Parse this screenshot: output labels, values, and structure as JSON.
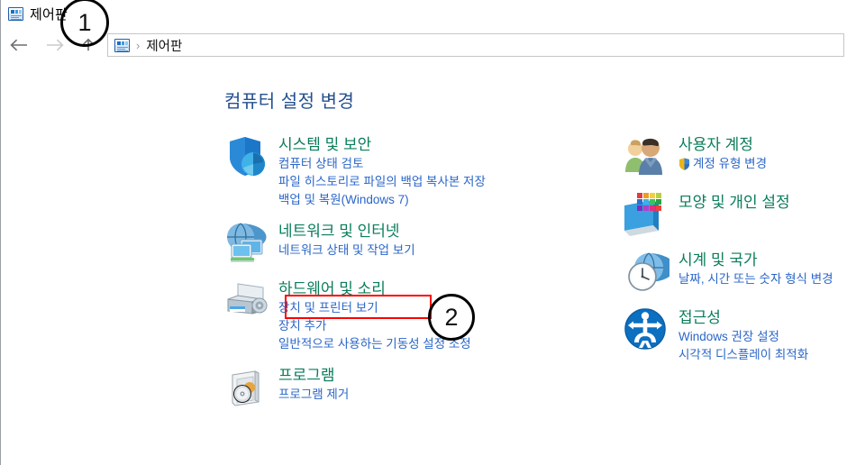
{
  "window": {
    "title": "제어판",
    "title_icon": "control-panel-icon"
  },
  "navbar": {
    "back_icon": "arrow-left-icon",
    "forward_icon": "arrow-right-icon",
    "up_icon": "arrow-up-icon",
    "breadcrumb_icon": "control-panel-icon",
    "breadcrumb_separator": "›",
    "breadcrumb": "제어판"
  },
  "main": {
    "page_title": "컴퓨터 설정 변경",
    "left_categories": [
      {
        "icon": "shield-security-icon",
        "title": "시스템 및 보안",
        "links": [
          "컴퓨터 상태 검토",
          "파일 히스토리로 파일의 백업 복사본 저장",
          "백업 및 복원(Windows 7)"
        ]
      },
      {
        "icon": "network-globe-icon",
        "title": "네트워크 및 인터넷",
        "links": [
          "네트워크 상태 및 작업 보기"
        ]
      },
      {
        "icon": "printer-icon",
        "title": "하드웨어 및 소리",
        "links": [
          "장치 및 프린터 보기",
          "장치 추가",
          "일반적으로 사용하는 기동성 설정 조정"
        ]
      },
      {
        "icon": "programs-cd-icon",
        "title": "프로그램",
        "links": [
          "프로그램 제거"
        ]
      }
    ],
    "right_categories": [
      {
        "icon": "user-accounts-icon",
        "title": "사용자 계정",
        "links": [
          {
            "text": "계정 유형 변경",
            "shield": true
          }
        ]
      },
      {
        "icon": "appearance-monitor-icon",
        "title": "모양 및 개인 설정",
        "links": []
      },
      {
        "icon": "clock-region-icon",
        "title": "시계 및 국가",
        "links": [
          {
            "text": "날짜, 시간 또는 숫자 형식 변경",
            "shield": false
          }
        ]
      },
      {
        "icon": "ease-of-access-icon",
        "title": "접근성",
        "links": [
          {
            "text": "Windows 권장 설정",
            "shield": false
          },
          {
            "text": "시각적 디스플레이 최적화",
            "shield": false
          }
        ]
      }
    ]
  },
  "annotations": {
    "markers": [
      {
        "label": "1",
        "target": "window-title"
      },
      {
        "label": "2",
        "target": "하드웨어 및 소리"
      }
    ],
    "highlight": {
      "target": "하드웨어 및 소리",
      "color": "#ff0000"
    }
  },
  "colors": {
    "category_title": "#0a7d5a",
    "link": "#2a66c8",
    "page_title": "#24508f",
    "highlight": "#ff0000",
    "marker": "#000000"
  }
}
